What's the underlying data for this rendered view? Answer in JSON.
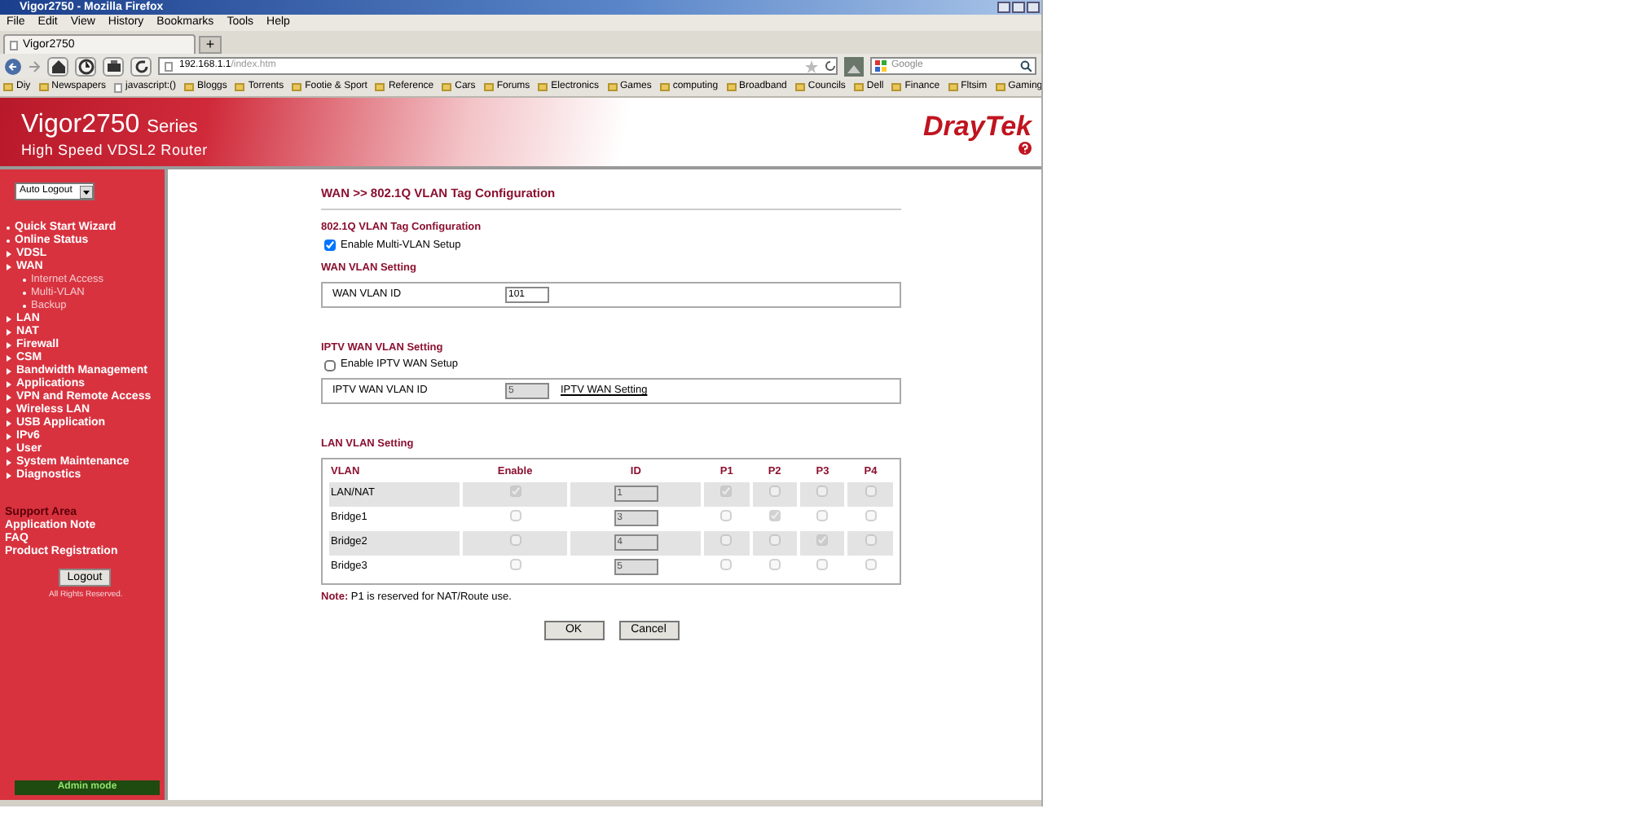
{
  "window": {
    "title": "Vigor2750 - Mozilla Firefox"
  },
  "menu": [
    "File",
    "Edit",
    "View",
    "History",
    "Bookmarks",
    "Tools",
    "Help"
  ],
  "tab": {
    "title": "Vigor2750",
    "new_tab": "+"
  },
  "address": {
    "host": "192.168.1.1",
    "path": "/index.htm"
  },
  "search": {
    "placeholder": "Google"
  },
  "bookmarks": [
    {
      "label": "Diy",
      "kind": "folder"
    },
    {
      "label": "Newspapers",
      "kind": "folder"
    },
    {
      "label": "javascript:()",
      "kind": "page"
    },
    {
      "label": "Bloggs",
      "kind": "folder"
    },
    {
      "label": "Torrents",
      "kind": "folder"
    },
    {
      "label": "Footie & Sport",
      "kind": "folder"
    },
    {
      "label": "Reference",
      "kind": "folder"
    },
    {
      "label": "Cars",
      "kind": "folder"
    },
    {
      "label": "Forums",
      "kind": "folder"
    },
    {
      "label": "Electronics",
      "kind": "folder"
    },
    {
      "label": "Games",
      "kind": "folder"
    },
    {
      "label": "computing",
      "kind": "folder"
    },
    {
      "label": "Broadband",
      "kind": "folder"
    },
    {
      "label": "Councils",
      "kind": "folder"
    },
    {
      "label": "Dell",
      "kind": "folder"
    },
    {
      "label": "Finance",
      "kind": "folder"
    },
    {
      "label": "Fltsim",
      "kind": "folder"
    },
    {
      "label": "Gaming",
      "kind": "folder"
    }
  ],
  "banner": {
    "model": "Vigor2750",
    "series": "Series",
    "subtitle": "High Speed VDSL2 Router",
    "brand": "DrayTek"
  },
  "sidebar": {
    "auto_logout": "Auto Logout",
    "items": [
      {
        "label": "Quick Start Wizard",
        "kind": "link"
      },
      {
        "label": "Online Status",
        "kind": "link"
      },
      {
        "label": "VDSL",
        "kind": "menu"
      },
      {
        "label": "WAN",
        "kind": "menu",
        "children": [
          {
            "label": "Internet Access"
          },
          {
            "label": "Multi-VLAN"
          },
          {
            "label": "Backup"
          }
        ]
      },
      {
        "label": "LAN",
        "kind": "menu"
      },
      {
        "label": "NAT",
        "kind": "menu"
      },
      {
        "label": "Firewall",
        "kind": "menu"
      },
      {
        "label": "CSM",
        "kind": "menu"
      },
      {
        "label": "Bandwidth Management",
        "kind": "menu"
      },
      {
        "label": "Applications",
        "kind": "menu"
      },
      {
        "label": "VPN and Remote Access",
        "kind": "menu"
      },
      {
        "label": "Wireless LAN",
        "kind": "menu"
      },
      {
        "label": "USB Application",
        "kind": "menu"
      },
      {
        "label": "IPv6",
        "kind": "menu"
      },
      {
        "label": "User",
        "kind": "menu"
      },
      {
        "label": "System Maintenance",
        "kind": "menu"
      },
      {
        "label": "Diagnostics",
        "kind": "menu"
      }
    ],
    "support_title": "Support Area",
    "support_links": [
      "Application Note",
      "FAQ",
      "Product Registration"
    ],
    "logout": "Logout",
    "rights": "All Rights Reserved.",
    "mode": "Admin mode"
  },
  "content": {
    "title": "WAN >> 802.1Q VLAN Tag Configuration",
    "tag_section": {
      "title": "802.1Q VLAN Tag Configuration",
      "checkbox": {
        "label": "Enable Multi-VLAN Setup",
        "checked": true
      }
    },
    "wan_section": {
      "title": "WAN VLAN Setting",
      "label": "WAN VLAN ID",
      "value": "101"
    },
    "iptv_section": {
      "title": "IPTV WAN VLAN Setting",
      "checkbox": {
        "label": "Enable IPTV WAN Setup",
        "checked": false
      },
      "label": "IPTV WAN VLAN ID",
      "value": "5",
      "disabled": true,
      "link": "IPTV WAN Setting"
    },
    "lan_section": {
      "title": "LAN VLAN Setting",
      "columns": [
        "VLAN",
        "Enable",
        "ID",
        "P1",
        "P2",
        "P3",
        "P4"
      ],
      "rows": [
        {
          "name": "LAN/NAT",
          "enable": true,
          "id": "1",
          "ports": [
            true,
            false,
            false,
            false
          ]
        },
        {
          "name": "Bridge1",
          "enable": false,
          "id": "3",
          "ports": [
            false,
            true,
            false,
            false
          ]
        },
        {
          "name": "Bridge2",
          "enable": false,
          "id": "4",
          "ports": [
            false,
            false,
            true,
            false
          ]
        },
        {
          "name": "Bridge3",
          "enable": false,
          "id": "5",
          "ports": [
            false,
            false,
            false,
            false
          ]
        }
      ]
    },
    "note": {
      "label": "Note:",
      "text": "P1 is reserved for NAT/Route use."
    },
    "buttons": [
      "OK",
      "Cancel"
    ]
  }
}
